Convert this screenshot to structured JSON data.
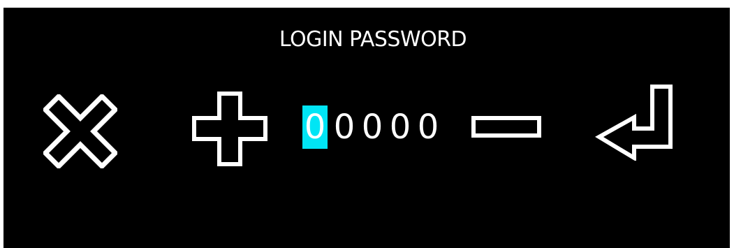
{
  "title": "LOGIN PASSWORD",
  "password": {
    "digits": [
      "0",
      "0",
      "0",
      "0",
      "0"
    ],
    "active_index": 0
  },
  "controls": {
    "cancel_icon": "close-x-icon",
    "increment_icon": "plus-icon",
    "decrement_icon": "minus-icon",
    "enter_icon": "enter-return-icon"
  },
  "colors": {
    "background": "#000000",
    "foreground": "#ffffff",
    "highlight": "#00e5f5"
  }
}
